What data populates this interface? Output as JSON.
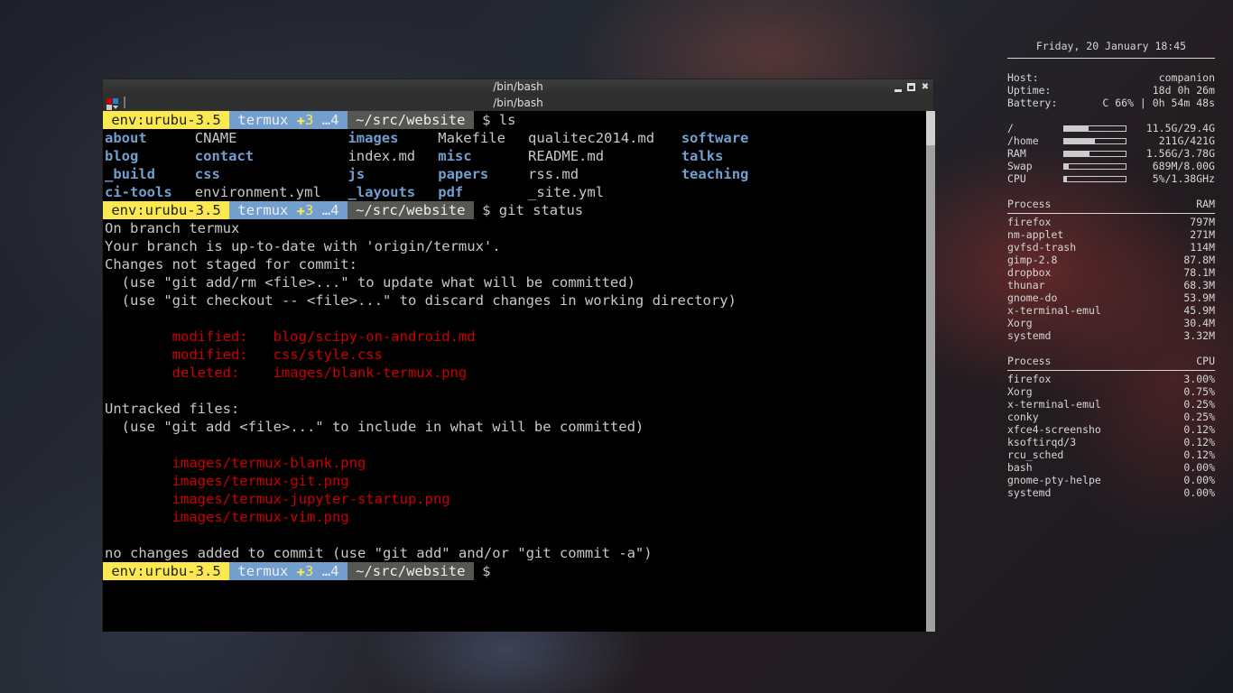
{
  "window": {
    "title": "/bin/bash",
    "tab_title": "/bin/bash",
    "buttons": {
      "minimize": "minimize",
      "maximize": "maximize",
      "close": "close"
    }
  },
  "prompt": {
    "env": "env:urubu-3.5",
    "branch": "termux",
    "staged_symbol": "✚",
    "staged_count": "3",
    "untracked": "…4",
    "cwd": "~/src/website",
    "symbol": "$"
  },
  "commands": [
    "ls",
    "git status",
    ""
  ],
  "ls_output": {
    "columns": [
      [
        {
          "name": "about",
          "type": "dir"
        },
        {
          "name": "blog",
          "type": "dir"
        },
        {
          "name": "_build",
          "type": "dir"
        },
        {
          "name": "ci-tools",
          "type": "dir"
        }
      ],
      [
        {
          "name": "CNAME",
          "type": "file"
        },
        {
          "name": "contact",
          "type": "dir"
        },
        {
          "name": "css",
          "type": "dir"
        },
        {
          "name": "environment.yml",
          "type": "file"
        }
      ],
      [
        {
          "name": "images",
          "type": "dir"
        },
        {
          "name": "index.md",
          "type": "file"
        },
        {
          "name": "js",
          "type": "dir"
        },
        {
          "name": "_layouts",
          "type": "dir"
        }
      ],
      [
        {
          "name": "Makefile",
          "type": "file"
        },
        {
          "name": "misc",
          "type": "dir"
        },
        {
          "name": "papers",
          "type": "dir"
        },
        {
          "name": "pdf",
          "type": "dir"
        }
      ],
      [
        {
          "name": "qualitec2014.md",
          "type": "file"
        },
        {
          "name": "README.md",
          "type": "file"
        },
        {
          "name": "rss.md",
          "type": "file"
        },
        {
          "name": "_site.yml",
          "type": "file"
        }
      ],
      [
        {
          "name": "software",
          "type": "dir"
        },
        {
          "name": "talks",
          "type": "dir"
        },
        {
          "name": "teaching",
          "type": "dir"
        }
      ]
    ]
  },
  "git_status": {
    "lines": [
      {
        "text": "On branch termux",
        "color": "normal"
      },
      {
        "text": "Your branch is up-to-date with 'origin/termux'.",
        "color": "normal"
      },
      {
        "text": "Changes not staged for commit:",
        "color": "normal"
      },
      {
        "text": "  (use \"git add/rm <file>...\" to update what will be committed)",
        "color": "normal"
      },
      {
        "text": "  (use \"git checkout -- <file>...\" to discard changes in working directory)",
        "color": "normal"
      },
      {
        "text": "",
        "color": "normal"
      },
      {
        "text": "        modified:   blog/scipy-on-android.md",
        "color": "red"
      },
      {
        "text": "        modified:   css/style.css",
        "color": "red"
      },
      {
        "text": "        deleted:    images/blank-termux.png",
        "color": "red"
      },
      {
        "text": "",
        "color": "normal"
      },
      {
        "text": "Untracked files:",
        "color": "normal"
      },
      {
        "text": "  (use \"git add <file>...\" to include in what will be committed)",
        "color": "normal"
      },
      {
        "text": "",
        "color": "normal"
      },
      {
        "text": "        images/termux-blank.png",
        "color": "red"
      },
      {
        "text": "        images/termux-git.png",
        "color": "red"
      },
      {
        "text": "        images/termux-jupyter-startup.png",
        "color": "red"
      },
      {
        "text": "        images/termux-vim.png",
        "color": "red"
      },
      {
        "text": "",
        "color": "normal"
      },
      {
        "text": "no changes added to commit (use \"git add\" and/or \"git commit -a\")",
        "color": "normal"
      }
    ]
  },
  "conky": {
    "datetime": "Friday, 20 January 18:45",
    "info": [
      {
        "label": "Host:",
        "value": "companion"
      },
      {
        "label": "Uptime:",
        "value": "18d 0h 26m"
      },
      {
        "label": "Battery:",
        "value": "C 66% | 0h 54m 48s"
      }
    ],
    "usage": [
      {
        "label": "/",
        "value": "11.5G/29.4G",
        "fraction": 0.39
      },
      {
        "label": "/home",
        "value": "211G/421G",
        "fraction": 0.5
      },
      {
        "label": "RAM",
        "value": "1.56G/3.78G",
        "fraction": 0.41
      },
      {
        "label": "Swap",
        "value": "689M/8.00G",
        "fraction": 0.08
      },
      {
        "label": "CPU",
        "value": "5%/1.38GHz",
        "fraction": 0.05
      }
    ],
    "ram_table": {
      "header": {
        "process": "Process",
        "metric": "RAM"
      },
      "rows": [
        {
          "name": "firefox",
          "value": "797M"
        },
        {
          "name": "nm-applet",
          "value": "271M"
        },
        {
          "name": "gvfsd-trash",
          "value": "114M"
        },
        {
          "name": "gimp-2.8",
          "value": "87.8M"
        },
        {
          "name": "dropbox",
          "value": "78.1M"
        },
        {
          "name": "thunar",
          "value": "68.3M"
        },
        {
          "name": "gnome-do",
          "value": "53.9M"
        },
        {
          "name": "x-terminal-emul",
          "value": "45.9M"
        },
        {
          "name": "Xorg",
          "value": "30.4M"
        },
        {
          "name": "systemd",
          "value": "3.32M"
        }
      ]
    },
    "cpu_table": {
      "header": {
        "process": "Process",
        "metric": "CPU"
      },
      "rows": [
        {
          "name": "firefox",
          "value": "3.00%"
        },
        {
          "name": "Xorg",
          "value": "0.75%"
        },
        {
          "name": "x-terminal-emul",
          "value": "0.25%"
        },
        {
          "name": "conky",
          "value": "0.25%"
        },
        {
          "name": "xfce4-screensho",
          "value": "0.12%"
        },
        {
          "name": "ksoftirqd/3",
          "value": "0.12%"
        },
        {
          "name": "rcu_sched",
          "value": "0.12%"
        },
        {
          "name": "bash",
          "value": "0.00%"
        },
        {
          "name": "gnome-pty-helpe",
          "value": "0.00%"
        },
        {
          "name": "systemd",
          "value": "0.00%"
        }
      ]
    }
  }
}
